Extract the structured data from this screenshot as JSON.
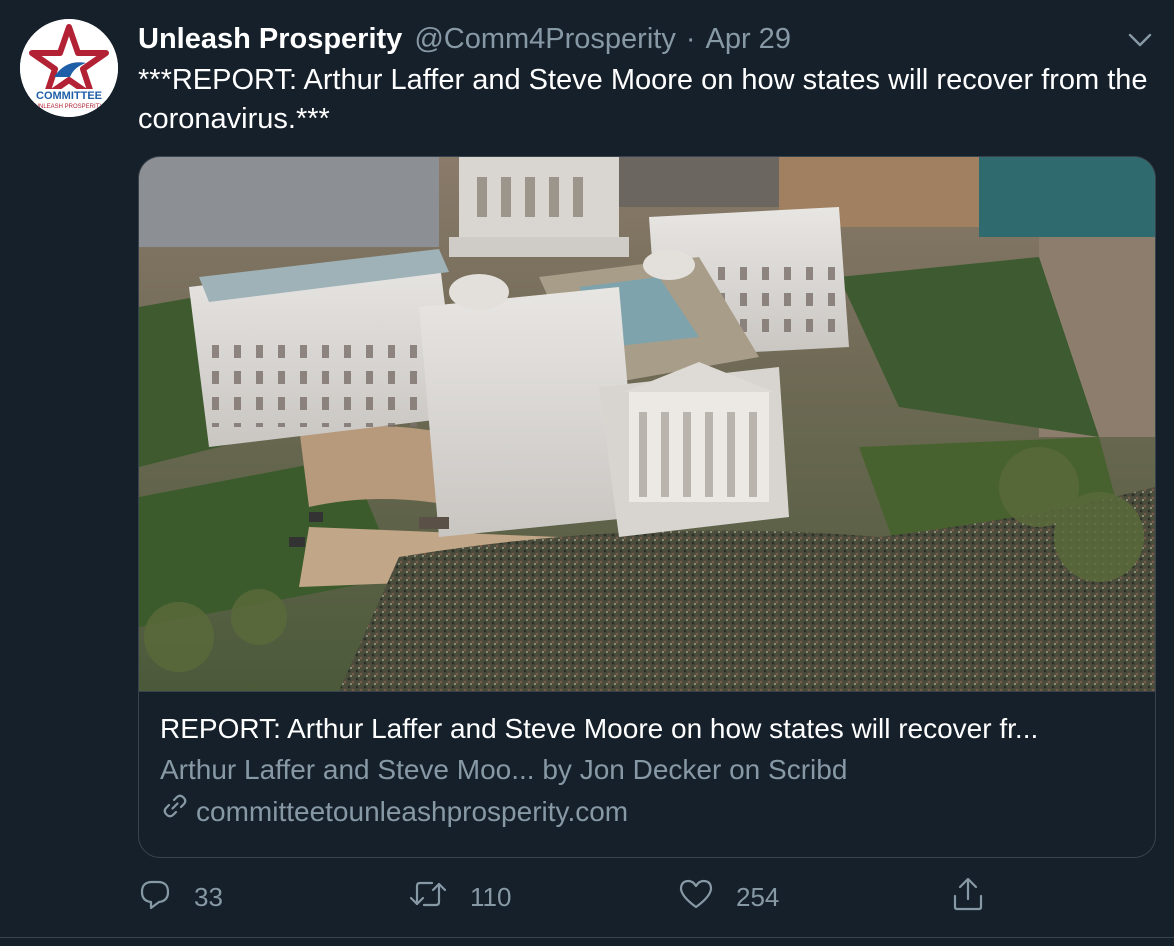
{
  "account": {
    "display_name": "Unleash Prosperity",
    "handle": "@Comm4Prosperity",
    "separator": "·",
    "date": "Apr 29",
    "avatar_text_top": "COMMITTEE",
    "avatar_text_bottom": "UNLEASH PROSPERITY"
  },
  "tweet": {
    "text": "***REPORT: Arthur Laffer and Steve Moore on how states will recover from the coronavirus.***"
  },
  "card": {
    "title": "REPORT: Arthur Laffer and Steve Moore on how states will recover fr...",
    "description": "Arthur Laffer and Steve Moo... by Jon Decker on Scribd",
    "domain": "committeetounleashprosperity.com",
    "image_subject": "aerial view of state capitol building with crowd"
  },
  "actions": {
    "replies": "33",
    "retweets": "110",
    "likes": "254"
  },
  "icons": {
    "reply": "reply-icon",
    "retweet": "retweet-icon",
    "like": "heart-icon",
    "share": "share-icon",
    "menu": "chevron-down-icon",
    "link": "link-icon"
  },
  "colors": {
    "background": "#15202b",
    "secondary_text": "#8899a6",
    "border": "#38444d",
    "brand_red": "#b22234",
    "brand_blue": "#1f5fa8"
  }
}
